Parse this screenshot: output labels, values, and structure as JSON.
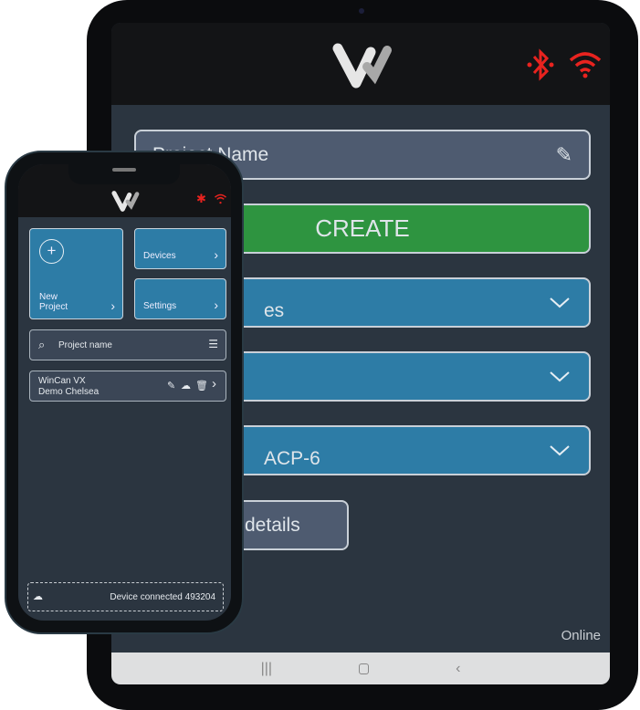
{
  "tablet": {
    "project_name_placeholder": "Project Name",
    "create_label": "CREATE",
    "dropdown_1_partial": "es",
    "dropdown_3_partial": "ACP-6",
    "details_partial": "details",
    "status": "Online",
    "icons": [
      "logo-w",
      "bluetooth-icon",
      "wifi-icon",
      "pencil-icon",
      "chevron-down-icon",
      "recents-icon",
      "home-icon",
      "back-icon"
    ],
    "colors": {
      "create": "#2e9440",
      "dropdown": "#2d7ca6",
      "alert_icons": "#e8231f"
    }
  },
  "phone": {
    "new_project": "New\nProject",
    "devices": "Devices",
    "settings": "Settings",
    "search_placeholder": "Project name",
    "project_item": {
      "line1": "WinCan VX",
      "line2": "Demo Chelsea"
    },
    "device_status": "Device connected 493204"
  }
}
